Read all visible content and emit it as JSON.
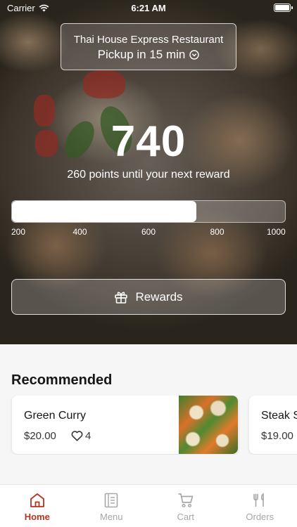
{
  "status_bar": {
    "carrier": "Carrier",
    "time": "6:21 AM"
  },
  "restaurant": {
    "name": "Thai House Express Restaurant",
    "pickup": "Pickup in 15 min"
  },
  "loyalty": {
    "points": "740",
    "caption": "260 points until your next reward",
    "progress_value": 740,
    "progress_min": 200,
    "progress_max": 1000,
    "ticks": [
      "200",
      "400",
      "600",
      "800",
      "1000"
    ],
    "rewards_label": "Rewards"
  },
  "recommended": {
    "title": "Recommended",
    "items": [
      {
        "name": "Green Curry",
        "price": "$20.00",
        "likes": "4"
      },
      {
        "name": "Steak S",
        "price": "$19.00"
      }
    ]
  },
  "tabs": [
    {
      "label": "Home",
      "icon": "home-icon",
      "active": true
    },
    {
      "label": "Menu",
      "icon": "menu-icon",
      "active": false
    },
    {
      "label": "Cart",
      "icon": "cart-icon",
      "active": false
    },
    {
      "label": "Orders",
      "icon": "orders-icon",
      "active": false
    }
  ],
  "colors": {
    "accent": "#b8321f",
    "inactive_tab": "#a7a7a7"
  }
}
